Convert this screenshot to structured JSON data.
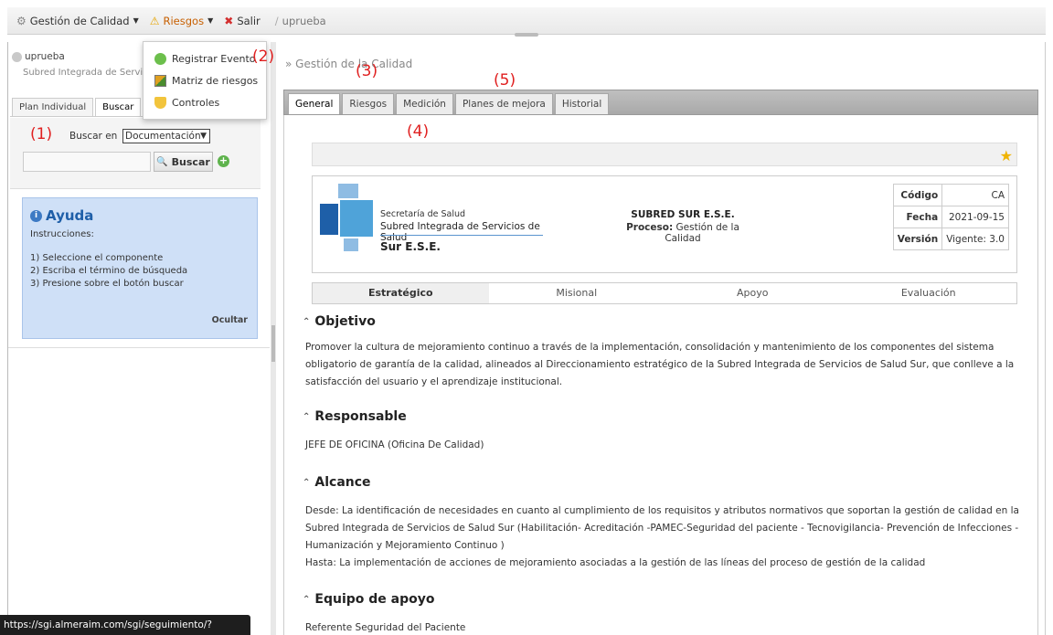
{
  "topbar": {
    "menus": [
      {
        "label": "Gestión de Calidad",
        "icon": "gear-icon"
      },
      {
        "label": "Riesgos",
        "icon": "warning-icon"
      },
      {
        "label": "Salir",
        "icon": "close-icon"
      }
    ],
    "user": "uprueba"
  },
  "dropdown": {
    "items": [
      {
        "label": "Registrar Evento",
        "icon": "add-circle-icon"
      },
      {
        "label": "Matriz de riesgos",
        "icon": "matrix-icon"
      },
      {
        "label": "Controles",
        "icon": "shield-icon"
      }
    ]
  },
  "annotations": {
    "a1": "(1)",
    "a2": "(2)",
    "a3": "(3)",
    "a4": "(4)",
    "a5": "(5)"
  },
  "left": {
    "user": "uprueba",
    "entity": "Subred Integrada de Servicios de Salud Sur",
    "tabs": [
      "Plan Individual",
      "Buscar"
    ],
    "search": {
      "label": "Buscar en",
      "selected": "Documentación",
      "button": "Buscar"
    },
    "help": {
      "title": "Ayuda",
      "subtitle": "Instrucciones:",
      "lines": [
        "1) Seleccione el componente",
        "2) Escriba el término de búsqueda",
        "3) Presione sobre el botón buscar"
      ],
      "hide": "Ocultar"
    }
  },
  "main": {
    "breadcrumb": "» Gestión de la Calidad",
    "tabs": [
      "General",
      "Riesgos",
      "Medición",
      "Planes de mejora",
      "Historial"
    ],
    "header": {
      "logo_line1": "Secretaría de Salud",
      "logo_line2": "Subred Integrada de Servicios de Salud",
      "logo_line3": "Sur E.S.E.",
      "org_name": "SUBRED SUR E.S.E.",
      "process_label": "Proceso:",
      "process_value": "Gestión de la Calidad",
      "info": [
        {
          "k": "Código",
          "v": "CA"
        },
        {
          "k": "Fecha",
          "v": "2021-09-15"
        },
        {
          "k": "Versión",
          "v": "Vigente: 3.0"
        }
      ]
    },
    "process_tabs": [
      "Estratégico",
      "Misional",
      "Apoyo",
      "Evaluación"
    ],
    "sections": {
      "objetivo": {
        "title": "Objetivo",
        "text": "Promover la cultura de mejoramiento continuo a través de la implementación, consolidación y mantenimiento de los componentes del sistema obligatorio de garantía de la calidad, alineados al Direccionamiento estratégico de la Subred Integrada de Servicios de Salud Sur, que conlleve a la satisfacción del usuario y el aprendizaje institucional."
      },
      "responsable": {
        "title": "Responsable",
        "text": "JEFE DE OFICINA (Oficina De Calidad)"
      },
      "alcance": {
        "title": "Alcance",
        "desde": "Desde: La identificación de necesidades en cuanto al cumplimiento de los requisitos y atributos normativos que soportan la gestión de calidad en la Subred Integrada de Servicios de Salud Sur (Habilitación- Acreditación -PAMEC-Seguridad del paciente - Tecnovigilancia- Prevención de Infecciones - Humanización y Mejoramiento Continuo )",
        "hasta": "Hasta: La implementación de acciones de mejoramiento asociadas a la gestión de las líneas del proceso de gestión de la calidad"
      },
      "equipo": {
        "title": "Equipo de apoyo",
        "text": "Referente Seguridad del Paciente"
      }
    }
  },
  "statusbar": "https://sgi.almeraim.com/sgi/seguimiento/?nosgim#"
}
